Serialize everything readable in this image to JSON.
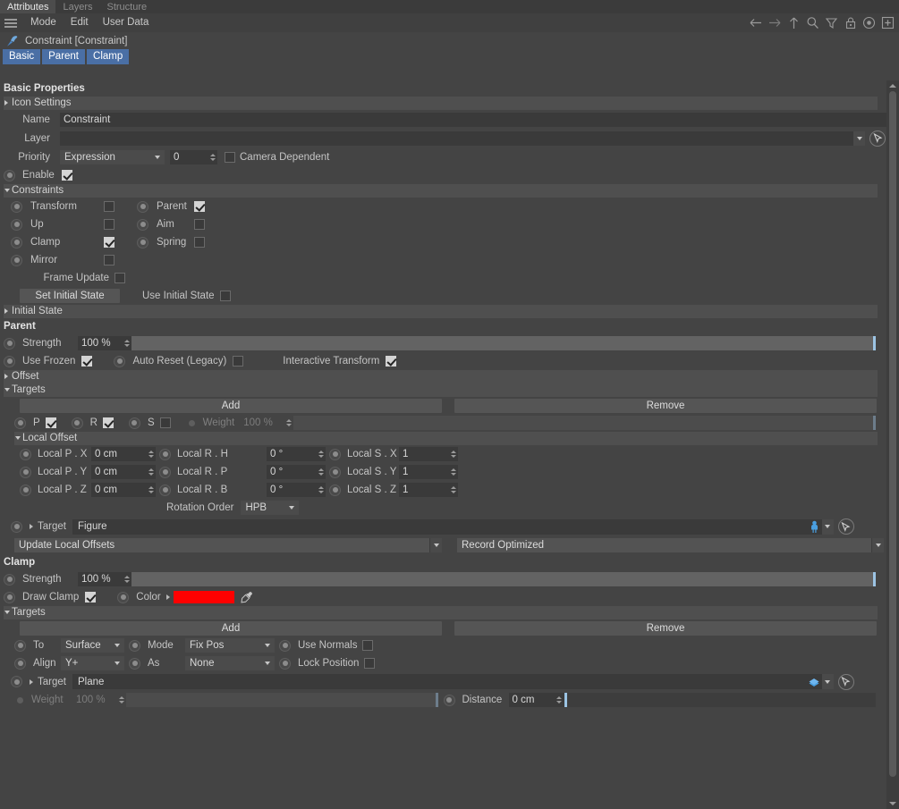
{
  "window": {
    "tabs": [
      {
        "label": "Attributes",
        "active": true
      },
      {
        "label": "Layers",
        "active": false
      },
      {
        "label": "Structure",
        "active": false
      }
    ],
    "menu": [
      "Mode",
      "Edit",
      "User Data"
    ],
    "toolbar_icons": [
      "arrow-left-icon",
      "arrow-right-icon",
      "arrow-up-icon",
      "search-icon",
      "filter-icon",
      "lock-icon",
      "target-icon",
      "add-box-icon"
    ]
  },
  "object": {
    "title": "Constraint [Constraint]",
    "icon": "pin-icon",
    "tabs": [
      "Basic",
      "Parent",
      "Clamp"
    ]
  },
  "basic": {
    "header": "Basic Properties",
    "icon_settings_group": "Icon Settings",
    "name_label": "Name",
    "name_value": "Constraint",
    "layer_label": "Layer",
    "layer_value": "",
    "priority_label": "Priority",
    "priority_value": "Expression",
    "priority_number": "0",
    "camera_dependent_label": "Camera Dependent",
    "camera_dependent_checked": false,
    "enable_label": "Enable",
    "enable_checked": true
  },
  "constraints": {
    "group_label": "Constraints",
    "items": [
      {
        "label": "Transform",
        "checked": false
      },
      {
        "label": "Parent",
        "checked": true
      },
      {
        "label": "Up",
        "checked": false
      },
      {
        "label": "Aim",
        "checked": false
      },
      {
        "label": "Clamp",
        "checked": true
      },
      {
        "label": "Spring",
        "checked": false
      },
      {
        "label": "Mirror",
        "checked": false
      }
    ],
    "frame_update_label": "Frame Update",
    "frame_update_checked": false,
    "set_initial_state_label": "Set Initial State",
    "use_initial_state_label": "Use Initial State",
    "use_initial_state_checked": false,
    "initial_state_group": "Initial State"
  },
  "parent": {
    "header": "Parent",
    "strength_label": "Strength",
    "strength_value": "100 %",
    "strength_pct": 100,
    "use_frozen_label": "Use Frozen",
    "use_frozen_checked": true,
    "auto_reset_label": "Auto Reset (Legacy)",
    "auto_reset_checked": false,
    "interactive_transform_label": "Interactive Transform",
    "interactive_transform_checked": true,
    "offset_group": "Offset",
    "targets_group": "Targets",
    "add_label": "Add",
    "remove_label": "Remove",
    "p_label": "P",
    "p_checked": true,
    "r_label": "R",
    "r_checked": true,
    "s_label": "S",
    "s_checked": false,
    "weight_label": "Weight",
    "weight_value": "100 %",
    "local_offset_group": "Local Offset",
    "local_pos": [
      {
        "label": "Local P . X",
        "value": "0 cm"
      },
      {
        "label": "Local P . Y",
        "value": "0 cm"
      },
      {
        "label": "Local P . Z",
        "value": "0 cm"
      }
    ],
    "local_rot": [
      {
        "label": "Local R . H",
        "value": "0 °"
      },
      {
        "label": "Local R . P",
        "value": "0 °"
      },
      {
        "label": "Local R . B",
        "value": "0 °"
      }
    ],
    "local_scale": [
      {
        "label": "Local S . X",
        "value": "1"
      },
      {
        "label": "Local S . Y",
        "value": "1"
      },
      {
        "label": "Local S . Z",
        "value": "1"
      }
    ],
    "rotation_order_label": "Rotation Order",
    "rotation_order_value": "HPB",
    "target_label": "Target",
    "target_value": "Figure",
    "target_icon": "figure-icon",
    "update_local_offsets_label": "Update Local Offsets",
    "record_optimized_label": "Record Optimized"
  },
  "clamp": {
    "header": "Clamp",
    "strength_label": "Strength",
    "strength_value": "100 %",
    "strength_pct": 100,
    "draw_clamp_label": "Draw Clamp",
    "draw_clamp_checked": true,
    "color_label": "Color",
    "color_value": "#ff0000",
    "eyedropper_icon": "eyedropper-icon",
    "targets_group": "Targets",
    "add_label": "Add",
    "remove_label": "Remove",
    "to_label": "To",
    "to_value": "Surface",
    "mode_label": "Mode",
    "mode_value": "Fix Pos",
    "use_normals_label": "Use Normals",
    "use_normals_checked": false,
    "align_label": "Align",
    "align_value": "Y+",
    "as_label": "As",
    "as_value": "None",
    "lock_position_label": "Lock Position",
    "lock_position_checked": false,
    "target_label": "Target",
    "target_value": "Plane",
    "target_icon": "plane-icon",
    "weight_label": "Weight",
    "weight_value": "100 %",
    "distance_label": "Distance",
    "distance_value": "0 cm"
  },
  "colors": {
    "accent_tab": "#4a6fa5",
    "panel_bg": "#444444",
    "field_bg": "#3a3a3a",
    "group_bg": "#4f4f4f",
    "clamp_color": "#ff0000"
  }
}
